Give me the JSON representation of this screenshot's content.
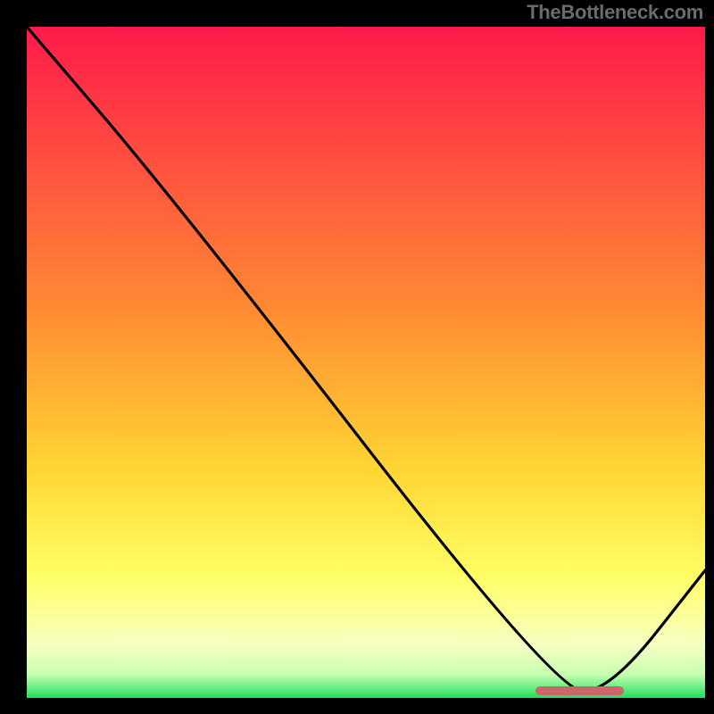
{
  "attribution_text": "TheBottleneck.com",
  "colors": {
    "top": "#ff1a4b",
    "mid_upper": "#ff8a33",
    "mid": "#ffd633",
    "mid_lower": "#ffff66",
    "pale": "#f7ffc2",
    "green": "#1fdf5e",
    "curve": "#000000",
    "marker": "#cc6767",
    "frame": "#000000"
  },
  "chart_data": {
    "type": "line",
    "title": "",
    "xlabel": "",
    "ylabel": "",
    "xlim": [
      0,
      100
    ],
    "ylim": [
      0,
      100
    ],
    "x": [
      0,
      22,
      78,
      86,
      100
    ],
    "values": [
      100,
      74,
      1,
      1,
      19
    ],
    "annotations": [
      {
        "kind": "marker-bar",
        "x_start": 75,
        "x_end": 88,
        "y": 1
      }
    ],
    "gradient_stops": [
      {
        "pos": 0.0,
        "color": "#ff1a4b"
      },
      {
        "pos": 0.42,
        "color": "#ff8a33"
      },
      {
        "pos": 0.66,
        "color": "#ffd633"
      },
      {
        "pos": 0.82,
        "color": "#ffff66"
      },
      {
        "pos": 0.92,
        "color": "#f7ffc2"
      },
      {
        "pos": 0.965,
        "color": "#c6ffb0"
      },
      {
        "pos": 1.0,
        "color": "#1fdf5e"
      }
    ]
  }
}
